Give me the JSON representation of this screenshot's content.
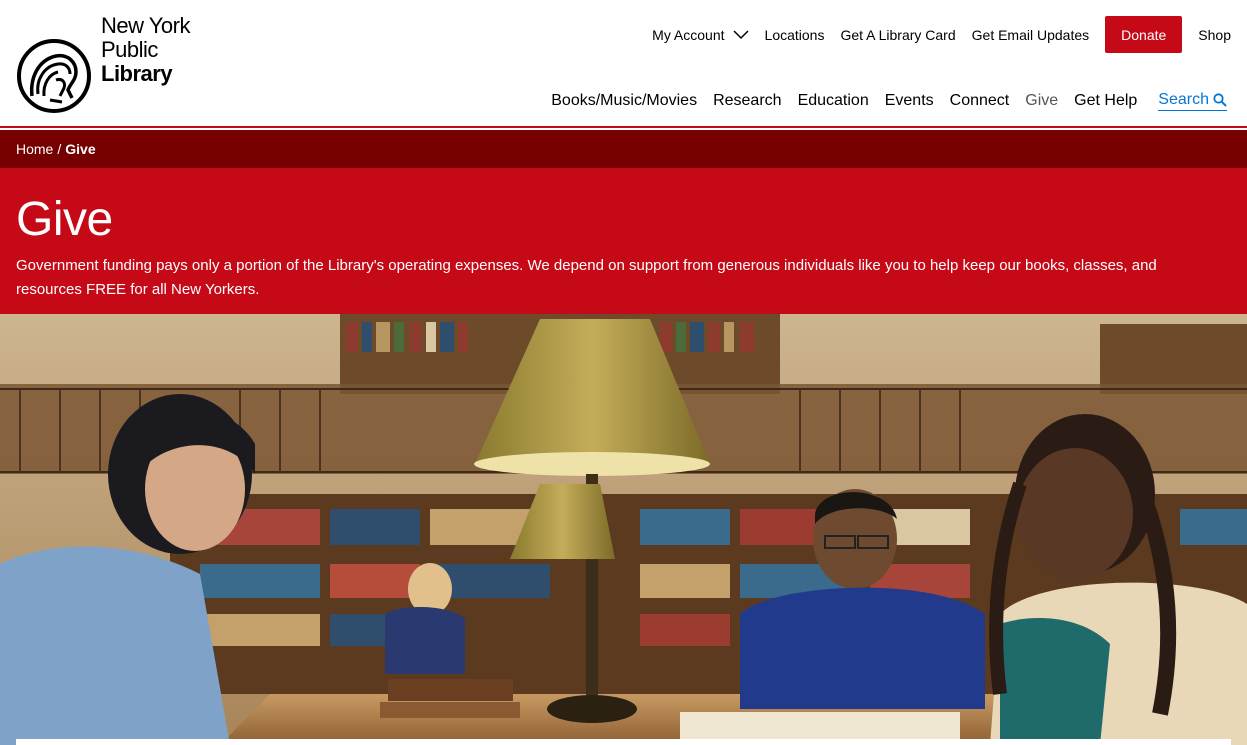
{
  "logo": {
    "line1": "New York",
    "line2": "Public",
    "line3": "Library"
  },
  "utility_nav": {
    "my_account": "My Account",
    "locations": "Locations",
    "library_card": "Get A Library Card",
    "email_updates": "Get Email Updates",
    "donate": "Donate",
    "shop": "Shop"
  },
  "main_nav": {
    "items": [
      "Books/Music/Movies",
      "Research",
      "Education",
      "Events",
      "Connect",
      "Give",
      "Get Help"
    ],
    "active": "Give",
    "search": "Search"
  },
  "breadcrumb": {
    "home": "Home",
    "separator": "/",
    "current": "Give"
  },
  "hero": {
    "title": "Give",
    "description": "Government funding pays only a portion of the Library's operating expenses. We depend on support from generous individuals like you to help keep our books, classes, and resources FREE for all New Yorkers."
  },
  "colors": {
    "brand_red": "#c60917",
    "breadcrumb_dark_red": "#760000",
    "link_blue": "#0576d3"
  }
}
